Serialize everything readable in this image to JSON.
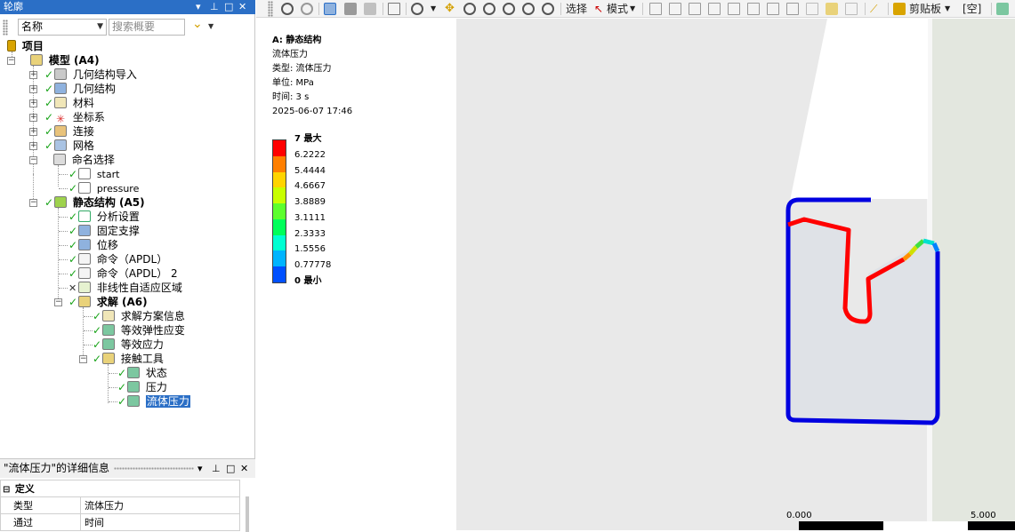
{
  "outline": {
    "title": "轮廓",
    "filter": {
      "field": "名称",
      "search_placeholder": "搜索概要"
    },
    "tree": {
      "project": "项目",
      "model": "模型 (A4)",
      "geometry_import": "几何结构导入",
      "geometry": "几何结构",
      "materials": "材料",
      "coordinate_systems": "坐标系",
      "connections": "连接",
      "mesh": "网格",
      "named_selections": "命名选择",
      "ns_start": "start",
      "ns_pressure": "pressure",
      "static_structural": "静态结构 (A5)",
      "analysis_settings": "分析设置",
      "fixed_support": "固定支撑",
      "displacement": "位移",
      "command_apdl_1": "命令（APDL）",
      "command_apdl_2": "命令（APDL） 2",
      "nonlinear_adaptive": "非线性自适应区域",
      "solution": "求解 (A6)",
      "solution_information": "求解方案信息",
      "equivalent_elastic_strain": "等效弹性应变",
      "equivalent_stress": "等效应力",
      "contact_tool": "接触工具",
      "status": "状态",
      "pressure": "压力",
      "fluid_pressure": "流体压力"
    }
  },
  "details": {
    "title": "\"流体压力\"的详细信息",
    "section": "定义",
    "rows": [
      {
        "key": "类型",
        "value": "流体压力"
      },
      {
        "key": "通过",
        "value": "时间"
      }
    ]
  },
  "toolbar": {
    "select_label": "选择",
    "mode_label": "模式",
    "clipboard_label": "剪贴板",
    "empty_label": "[空]"
  },
  "viewport": {
    "info": {
      "analysis": "A: 静态结构",
      "result": "流体压力",
      "type": "类型: 流体压力",
      "unit": "单位: MPa",
      "time": "时间: 3 s",
      "date": "2025-06-07 17:46"
    },
    "legend": {
      "labels": [
        "7 最大",
        "6.2222",
        "5.4444",
        "4.6667",
        "3.8889",
        "3.1111",
        "2.3333",
        "1.5556",
        "0.77778",
        "0 最小"
      ],
      "colors": [
        "#ff0000",
        "#ff7f00",
        "#ffd400",
        "#c8ff00",
        "#5cff2e",
        "#00ff5a",
        "#00ffd2",
        "#00b4ff",
        "#0050ff"
      ]
    },
    "scale": {
      "left": "0.000",
      "right": "5.000"
    }
  },
  "colors": {
    "accent": "#2b6fc6",
    "check": "#19a319"
  }
}
